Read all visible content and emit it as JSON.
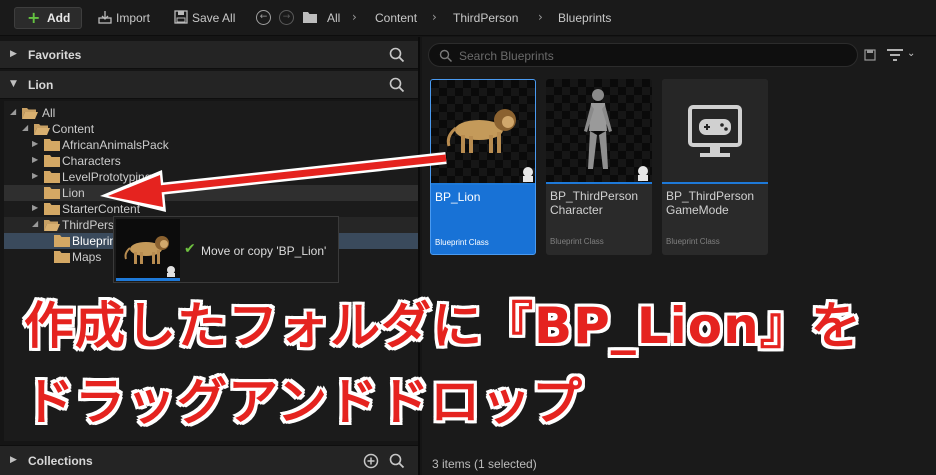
{
  "toolbar": {
    "add_label": "Add",
    "import_label": "Import",
    "save_all_label": "Save All",
    "breadcrumbs": [
      "All",
      "Content",
      "ThirdPerson",
      "Blueprints"
    ]
  },
  "sidebar": {
    "favorites_title": "Favorites",
    "project_title": "Lion",
    "collections_title": "Collections",
    "tree": [
      {
        "label": "All",
        "depth": 0,
        "expanded": true
      },
      {
        "label": "Content",
        "depth": 1,
        "expanded": true
      },
      {
        "label": "AfricanAnimalsPack",
        "depth": 2,
        "expanded": false
      },
      {
        "label": "Characters",
        "depth": 2,
        "expanded": false
      },
      {
        "label": "LevelPrototyping",
        "depth": 2,
        "expanded": false
      },
      {
        "label": "Lion",
        "depth": 2,
        "expanded": false,
        "highlighted": true
      },
      {
        "label": "StarterContent",
        "depth": 2,
        "expanded": false
      },
      {
        "label": "ThirdPerson",
        "depth": 2,
        "expanded": true
      },
      {
        "label": "Blueprints",
        "depth": 3,
        "selected": true
      },
      {
        "label": "Maps",
        "depth": 3
      }
    ]
  },
  "drag_tooltip": {
    "message": "Move or copy 'BP_Lion'"
  },
  "content": {
    "search_placeholder": "Search Blueprints",
    "assets": [
      {
        "name": "BP_Lion",
        "type": "Blueprint Class",
        "selected": true,
        "icon": "lion-thumbnail"
      },
      {
        "name": "BP_ThirdPerson Character",
        "type": "Blueprint Class",
        "selected": false,
        "icon": "mannequin-thumbnail"
      },
      {
        "name": "BP_ThirdPerson GameMode",
        "type": "Blueprint Class",
        "selected": false,
        "icon": "gamepad-monitor-icon"
      }
    ],
    "status": "3 items (1 selected)"
  },
  "annotation": {
    "line1": "作成したフォルダに『BP_Lion』を",
    "line2": "ドラッグアンドドロップ",
    "color": "#e5231f"
  },
  "colors": {
    "accent": "#1e79d8",
    "add_plus": "#64c241",
    "check": "#6ec040"
  }
}
